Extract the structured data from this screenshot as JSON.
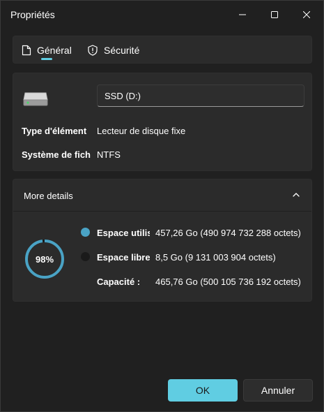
{
  "window": {
    "title": "Propriétés"
  },
  "tabs": [
    {
      "label": "Général",
      "icon": "document-icon",
      "selected": true
    },
    {
      "label": "Sécurité",
      "icon": "shield-icon",
      "selected": false
    }
  ],
  "drive": {
    "icon": "drive-icon",
    "name": "SSD (D:)",
    "type_label": "Type d'élément",
    "type_value": "Lecteur de disque fixe",
    "fs_label": "Système de fich",
    "fs_value": "NTFS"
  },
  "details": {
    "title": "More details",
    "expanded": true,
    "percent_used": 98,
    "percent_label": "98%",
    "used_label": "Espace utilis",
    "used_value": "457,26 Go (490 974 732 288 octets)",
    "free_label": "Espace libre",
    "free_value": "8,5 Go (9 131 003 904 octets)",
    "capacity_label": "Capacité :",
    "capacity_value": "465,76 Go (500 105 736 192 octets)",
    "colors": {
      "used": "#4aa3c5",
      "free": "#1a1a1a"
    }
  },
  "buttons": {
    "ok": "OK",
    "cancel": "Annuler"
  },
  "colors": {
    "accent": "#60cde2",
    "background": "#202020",
    "card": "#2b2b2b"
  }
}
